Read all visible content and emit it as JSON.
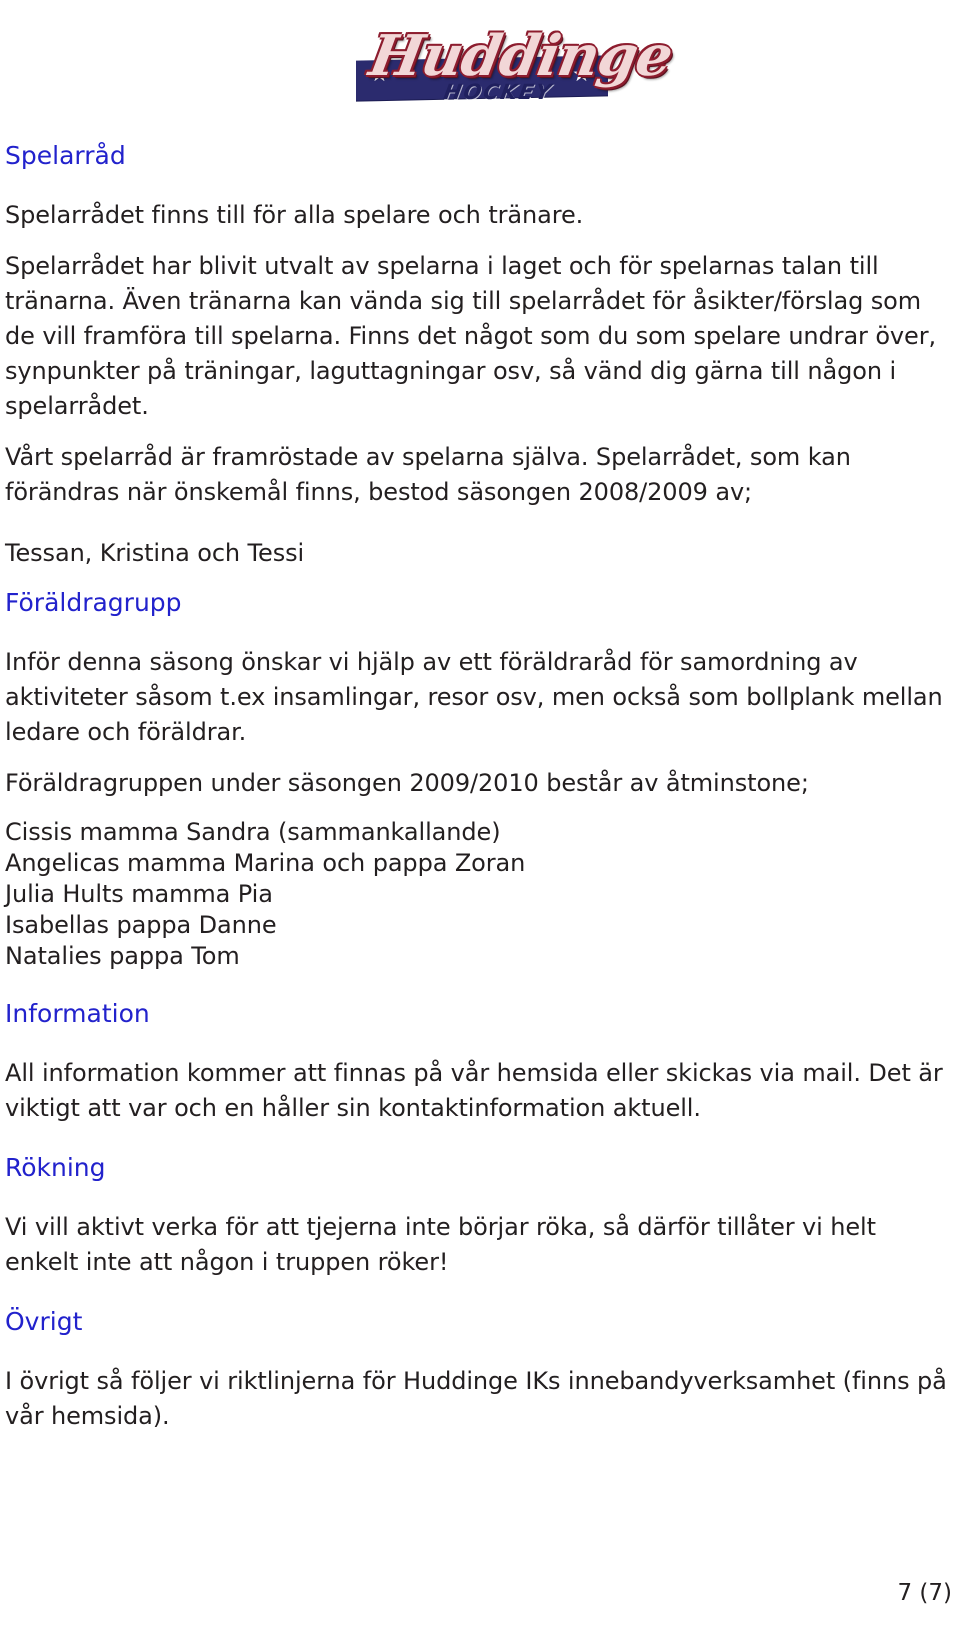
{
  "logo": {
    "name": "huddinge-hockey-logo",
    "script_text": "Huddinge",
    "sub_text": "HOCKEY",
    "star_glyph": "★",
    "colors": {
      "banner_navy": "#2b2b6e",
      "script_red": "#8d1c2e",
      "script_fill": "#f2d7d7"
    }
  },
  "document": {
    "heading_color": "#2222cc",
    "body_color": "#231f20"
  },
  "sections": {
    "spelarrad": {
      "heading": "Spelarråd",
      "p1": "Spelarrådet finns till för alla spelare och tränare.",
      "p2": "Spelarrådet har blivit utvalt av spelarna i laget och för spelarnas talan till tränarna. Även tränarna kan vända sig till spelarrådet för åsikter/förslag som de vill framföra till spelarna. Finns det något som du som spelare undrar över, synpunkter på träningar, laguttagningar osv, så vänd dig gärna till någon i spelarrådet.",
      "p3": "Vårt spelarråd är framröstade av spelarna själva. Spelarrådet, som kan förändras när önskemål finns, bestod säsongen 2008/2009 av;",
      "members": "Tessan, Kristina och Tessi"
    },
    "foraldragrupp": {
      "heading": "Föräldragrupp",
      "p1": "Inför denna säsong önskar vi hjälp av ett föräldraråd för samordning av aktiviteter såsom t.ex insamlingar, resor osv, men också som bollplank mellan ledare och föräldrar.",
      "p2": "Föräldragruppen under säsongen 2009/2010 består av åtminstone;",
      "members": [
        "Cissis mamma Sandra (sammankallande)",
        "Angelicas mamma Marina och pappa Zoran",
        "Julia Hults mamma Pia",
        "Isabellas pappa Danne",
        "Natalies pappa Tom"
      ]
    },
    "information": {
      "heading": "Information",
      "p1": "All information kommer att finnas på vår hemsida eller skickas via mail. Det är viktigt att var och en håller sin kontaktinformation aktuell."
    },
    "rokning": {
      "heading": "Rökning",
      "p1": "Vi vill aktivt verka för att tjejerna inte börjar röka, så därför tillåter vi helt enkelt inte att någon i truppen röker!"
    },
    "ovrigt": {
      "heading": "Övrigt",
      "p1": "I övrigt så följer vi riktlinjerna för Huddinge IKs innebandyverksamhet (finns på vår hemsida)."
    }
  },
  "footer": {
    "page_number": "7 (7)"
  }
}
